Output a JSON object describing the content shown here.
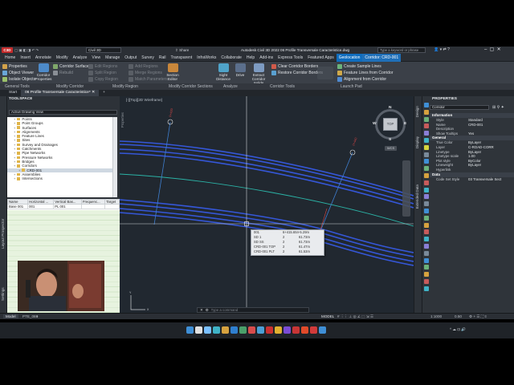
{
  "title_bar": {
    "app_menu": "C3D",
    "workspace": "Civil 3D",
    "share_label": "Share",
    "window_title": "Autodesk Civil 3D 2022   06 Profile Transversale Caracteristice.dwg",
    "search_placeholder": "Type a keyword or phrase"
  },
  "menu_tabs": [
    "Home",
    "Insert",
    "Annotate",
    "Modify",
    "Analyze",
    "View",
    "Manage",
    "Output",
    "Survey",
    "Rail",
    "Transparent",
    "InfraWorks",
    "Collaborate",
    "Help",
    "Add-ins",
    "Express Tools",
    "Featured Apps",
    "Geolocation",
    "Corridor: CRD-001"
  ],
  "ribbon": {
    "general_tools": [
      "Properties",
      "Object Viewer",
      "Isolate Objects"
    ],
    "corridor_properties": "Corridor Properties",
    "corridor_surfaces": "Corridor Surfaces",
    "rebuild_items": [
      "Rebuild",
      "Edit Regions",
      "Split Region",
      "Copy Region",
      "Add Regions",
      "Merge Regions",
      "Match Parameters"
    ],
    "section_editor": "Section Editor",
    "sight_distance": "Sight Distance",
    "drive": "Drive",
    "extract_corridor_solids": "Extract Corridor Solids",
    "clear_feature_lines": "Clear Corridor Borders",
    "restore_feature_lines": "Restore Corridor Borders",
    "create_sample_lines": "Create Sample Lines",
    "feature_lines_from_corridor": "Feature Lines from Corridor",
    "alignment_from_corridor": "Alignment from Corridor",
    "group_labels": [
      "General Tools",
      "Modify Corridor",
      "Modify Region",
      "Modify Corridor Sections",
      "Analyze",
      "Corridor Tools",
      "Launch Pad"
    ]
  },
  "doc_tabs": [
    "Start",
    "06 Profile Transversale Caracteristice*"
  ],
  "toolspace": {
    "title": "TOOLSPACE",
    "header": "Active Drawing View",
    "items": [
      {
        "label": "Points",
        "indent": 1
      },
      {
        "label": "Point Groups",
        "indent": 1
      },
      {
        "label": "Surfaces",
        "indent": 1
      },
      {
        "label": "Alignments",
        "indent": 1
      },
      {
        "label": "Feature Lines",
        "indent": 1
      },
      {
        "label": "Sites",
        "indent": 1
      },
      {
        "label": "Survey and Drainages",
        "indent": 1
      },
      {
        "label": "Catchments",
        "indent": 1
      },
      {
        "label": "Pipe Networks",
        "indent": 1
      },
      {
        "label": "Pressure Networks",
        "indent": 1
      },
      {
        "label": "Bridges",
        "indent": 1
      },
      {
        "label": "Corridors",
        "indent": 1
      },
      {
        "label": "CRD-001",
        "indent": 2,
        "selected": true
      },
      {
        "label": "Assemblies",
        "indent": 1
      },
      {
        "label": "Intersections",
        "indent": 1
      }
    ],
    "side_tabs": [
      "Layout Prospector",
      "Settings",
      "Survey",
      "Toolbox"
    ]
  },
  "grid": {
    "columns": [
      "Name",
      "Horizontal ...",
      "Vertical Bas...",
      "Frequenc...",
      "Target"
    ],
    "rows": [
      [
        "Base 001",
        "001",
        "PL 001",
        "",
        ""
      ]
    ]
  },
  "viewport": {
    "label": "[-][Top][2D Wireframe]",
    "viewcube_top": "TOP",
    "compass": {
      "n": "N",
      "e": "E",
      "s": "S",
      "w": "W"
    },
    "wcs": "WCS",
    "tooltip": [
      [
        "001",
        "6+415.65m",
        "-5.29m"
      ],
      [
        "SD 1",
        "2",
        "61.73m"
      ],
      [
        "SD SS",
        "2",
        "61.73m"
      ],
      [
        "CRD-001 TOP",
        "2",
        "61.47m"
      ],
      [
        "CRD-001 PLT",
        "2",
        "61.53m"
      ]
    ],
    "ruler_label": "200"
  },
  "properties": {
    "title": "PROPERTIES",
    "selector": "Corridor",
    "sections": [
      {
        "name": "Information",
        "rows": [
          [
            "Style",
            "Standard"
          ],
          [
            "Name",
            "CRD-001"
          ],
          [
            "Description",
            ""
          ],
          [
            "Show Tooltips",
            "Yes"
          ]
        ]
      },
      {
        "name": "General",
        "rows": [
          [
            "True Color",
            "ByLayer"
          ],
          [
            "Layer",
            "C-ROAD-CORR"
          ],
          [
            "Linetype",
            "ByLayer"
          ],
          [
            "Linetype scale",
            "1.00"
          ],
          [
            "Plot style",
            "ByColor"
          ],
          [
            "Lineweight",
            "ByLayer"
          ],
          [
            "Hyperlink",
            ""
          ]
        ]
      },
      {
        "name": "Data",
        "rows": [
          [
            "Code Set Style",
            "03 Transversale Sect"
          ]
        ]
      }
    ],
    "side_tabs": [
      "Design",
      "Display",
      "Extended Data"
    ]
  },
  "layout_tabs": [
    "Model",
    "PTE_088"
  ],
  "command_placeholder": "Type a command",
  "status": {
    "model": "MODEL",
    "scale": "1:1000",
    "zoom": "0.50"
  },
  "taskbar": {
    "time": "",
    "date": ""
  }
}
